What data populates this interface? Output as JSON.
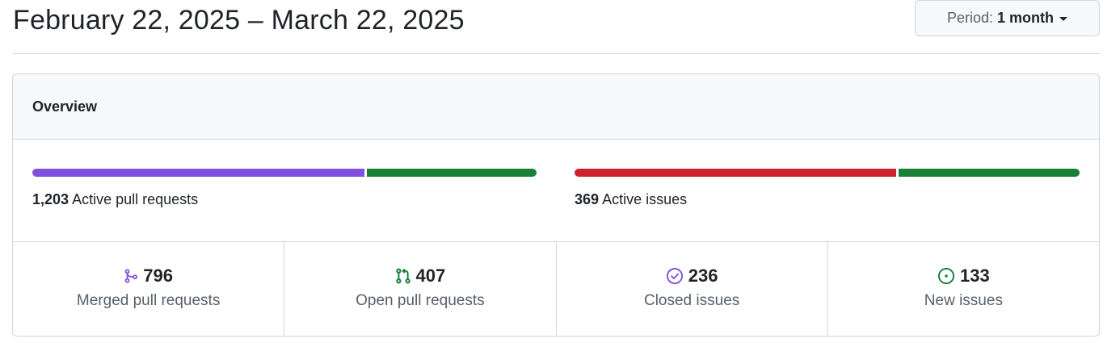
{
  "header": {
    "date_range": "February 22, 2025 – March 22, 2025",
    "period_label": "Period:",
    "period_value": "1 month"
  },
  "overview": {
    "title": "Overview",
    "pull_requests": {
      "count": "1,203",
      "label": "Active pull requests",
      "segments": [
        {
          "name": "merged",
          "value": 796,
          "color": "#8250df"
        },
        {
          "name": "open",
          "value": 407,
          "color": "#1a7f37"
        }
      ]
    },
    "issues": {
      "count": "369",
      "label": "Active issues",
      "segments": [
        {
          "name": "closed",
          "value": 236,
          "color": "#cf222e"
        },
        {
          "name": "new",
          "value": 133,
          "color": "#1a7f37"
        }
      ]
    },
    "stats": [
      {
        "icon": "git-merge-icon",
        "value": "796",
        "label": "Merged pull requests",
        "color": "#8250df"
      },
      {
        "icon": "git-pull-request-icon",
        "value": "407",
        "label": "Open pull requests",
        "color": "#1a7f37"
      },
      {
        "icon": "issue-closed-icon",
        "value": "236",
        "label": "Closed issues",
        "color": "#8250df"
      },
      {
        "icon": "issue-opened-icon",
        "value": "133",
        "label": "New issues",
        "color": "#1a7f37"
      }
    ]
  }
}
